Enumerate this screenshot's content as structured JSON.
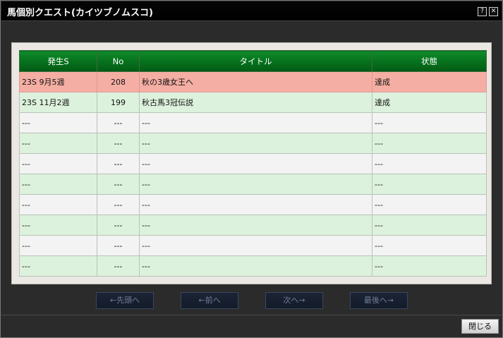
{
  "window": {
    "title": "馬個別クエスト(カイツブノムスコ)",
    "help_label": "?",
    "close_label": "✕"
  },
  "table": {
    "headers": [
      "発生S",
      "No",
      "タイトル",
      "状態"
    ],
    "rows": [
      {
        "season": "23S 9月5週",
        "no": "208",
        "title": "秋の3歳女王へ",
        "status": "達成",
        "style": "selected"
      },
      {
        "season": "23S 11月2週",
        "no": "199",
        "title": "秋古馬3冠伝説",
        "status": "達成",
        "style": "green"
      },
      {
        "season": "---",
        "no": "---",
        "title": "---",
        "status": "---",
        "style": "white"
      },
      {
        "season": "---",
        "no": "---",
        "title": "---",
        "status": "---",
        "style": "green"
      },
      {
        "season": "---",
        "no": "---",
        "title": "---",
        "status": "---",
        "style": "white"
      },
      {
        "season": "---",
        "no": "---",
        "title": "---",
        "status": "---",
        "style": "green"
      },
      {
        "season": "---",
        "no": "---",
        "title": "---",
        "status": "---",
        "style": "white"
      },
      {
        "season": "---",
        "no": "---",
        "title": "---",
        "status": "---",
        "style": "green"
      },
      {
        "season": "---",
        "no": "---",
        "title": "---",
        "status": "---",
        "style": "white"
      },
      {
        "season": "---",
        "no": "---",
        "title": "---",
        "status": "---",
        "style": "green"
      }
    ]
  },
  "pagination": {
    "first_label": "←先頭へ",
    "prev_label": "←前へ",
    "next_label": "次へ→",
    "last_label": "最後へ→"
  },
  "footer": {
    "close_label": "閉じる"
  },
  "colors": {
    "header_green": "#07761f",
    "row_green": "#ddf2dd",
    "row_white": "#f3f3f3",
    "row_selected": "#f5aea3"
  }
}
